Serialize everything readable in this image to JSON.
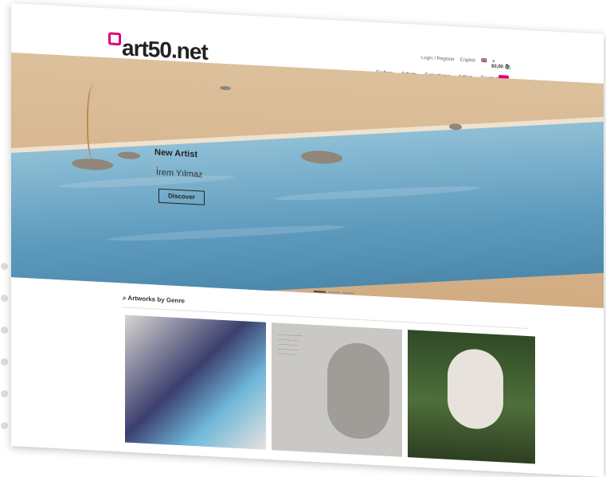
{
  "header": {
    "logo_text": "art50.net",
    "top_links": {
      "login": "Login / Register",
      "language": "English"
    },
    "cart": "$0,00"
  },
  "nav": {
    "items": [
      "Gallery",
      "Artists",
      "Selections",
      "Artlog",
      "Contact"
    ]
  },
  "hero": {
    "title": "New Artist",
    "subtitle": "İrem Yılmaz",
    "button": "Discover"
  },
  "section": {
    "title": "Artworks by Genre"
  },
  "icons": {
    "search": "search-icon",
    "cart": "cart-icon",
    "flag": "flag-icon"
  },
  "colors": {
    "accent": "#e0007a"
  }
}
